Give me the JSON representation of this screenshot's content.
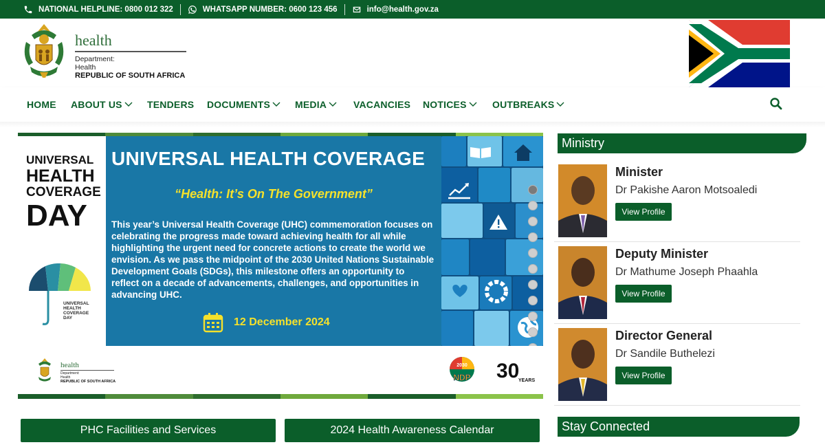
{
  "topbar": {
    "helpline": "NATIONAL HELPLINE: 0800 012 322",
    "whatsapp": "WHATSAPP NUMBER: 0600 123 456",
    "email": "info@health.gov.za"
  },
  "header": {
    "dept_title": "health",
    "dept_line1": "Department:",
    "dept_line2": "Health",
    "dept_line3": "REPUBLIC OF SOUTH AFRICA"
  },
  "nav": {
    "items": [
      {
        "label": "HOME",
        "dropdown": false
      },
      {
        "label": "ABOUT US",
        "dropdown": true
      },
      {
        "label": "TENDERS",
        "dropdown": false
      },
      {
        "label": "DOCUMENTS",
        "dropdown": true
      },
      {
        "label": "MEDIA",
        "dropdown": true
      },
      {
        "label": "VACANCIES",
        "dropdown": false
      },
      {
        "label": "NOTICES",
        "dropdown": true
      },
      {
        "label": "OUTBREAKS",
        "dropdown": true
      }
    ]
  },
  "banner": {
    "left_title": [
      "UNIVERSAL",
      "HEALTH",
      "COVERAGE",
      "DAY"
    ],
    "umbrella_text": [
      "UNIVERSAL",
      "HEALTH",
      "COVERAGE",
      "DAY"
    ],
    "title": "UNIVERSAL HEALTH COVERAGE",
    "subtitle": "“Health: It’s On The Government”",
    "body": "This year’s Universal Health Coverage (UHC) commemoration focuses on celebrating the progress made toward achieving health for all while highlighting the urgent need for concrete actions to create the world we envision. As we pass the midpoint of the 2030 United Nations Sustainable Development Goals (SDGs), this milestone offers an opportunity to reflect on a decade of advancements, challenges, and opportunities in advancing UHC.",
    "date": "12 December 2024",
    "footer_dept": {
      "title": "health",
      "l1": "Department:",
      "l2": "Health",
      "l3": "REPUBLIC OF SOUTH AFRICA"
    },
    "ndp_label": "NDP",
    "ndp_year": "2030",
    "years_number": "30",
    "years_label": "YEARS",
    "slide_count": 11,
    "active_slide": 1
  },
  "quick_links": {
    "phc": "PHC Facilities and Services",
    "calendar": "2024 Health Awareness Calendar"
  },
  "sidebar": {
    "ministry_heading": "Ministry",
    "stay_heading": "Stay Connected",
    "people": [
      {
        "role": "Minister",
        "name": "Dr Pakishe Aaron Motsoaledi",
        "button": "View Profile"
      },
      {
        "role": "Deputy Minister",
        "name": "Dr Mathume Joseph Phaahla",
        "button": "View Profile"
      },
      {
        "role": "Director General",
        "name": "Dr Sandile Buthelezi",
        "button": "View Profile"
      }
    ]
  },
  "colors": {
    "brand_green": "#0b5e2a",
    "banner_blue": "#1977a6",
    "accent_yellow": "#f5e12b"
  }
}
